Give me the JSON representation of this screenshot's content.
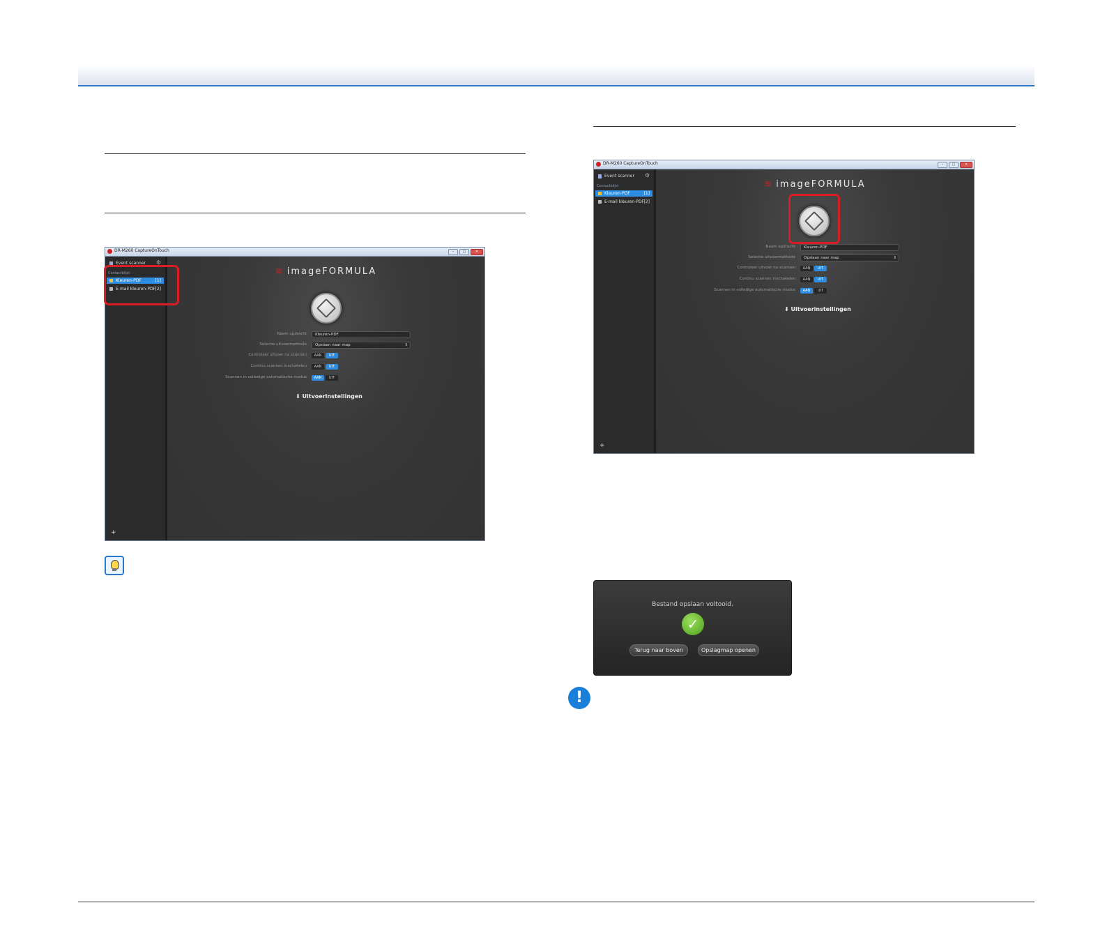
{
  "app": {
    "window_title": "DR-M260 CaptureOnTouch",
    "scanner_label": "Event scanner",
    "group_label": "Contactblijst",
    "items": [
      {
        "label": "Kleuren-PDF",
        "count": "[1]"
      },
      {
        "label": "E-mail kleuren-PDF",
        "count": "[2]"
      }
    ],
    "logo_text": "imageFORMULA",
    "fields": {
      "name_label": "Naam opdracht",
      "name_value": "Kleuren-PDF",
      "method_label": "Selectie uitvoermethode",
      "method_value": "Opslaan naar map",
      "check_label": "Controleer uitvoer na scannen",
      "continuous_label": "Continu scannen inschakelen",
      "auto_label": "Scannen in volledige automatische modus"
    },
    "toggle": {
      "on": "AAN",
      "off": "UIT"
    },
    "output_settings": "Uitvoerinstellingen",
    "add": "+"
  },
  "dialog": {
    "message": "Bestand opslaan voltooid.",
    "back_button": "Terug naar boven",
    "open_button": "Opslagmap openen"
  },
  "icons": {
    "tip": "lightbulb-hint-icon",
    "important": "exclamation-important-icon"
  }
}
